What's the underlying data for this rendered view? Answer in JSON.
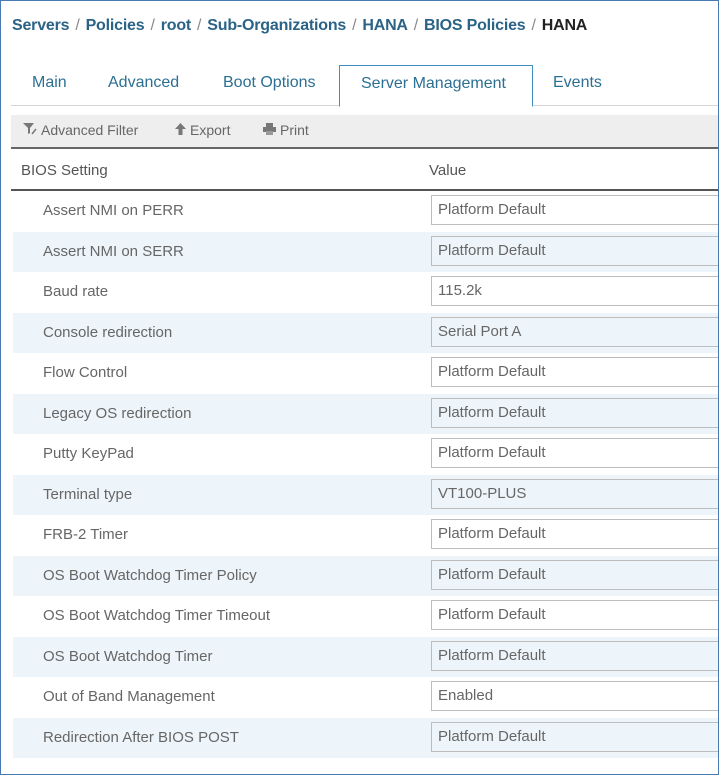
{
  "breadcrumb": {
    "items": [
      "Servers",
      "Policies",
      "root",
      "Sub-Organizations",
      "HANA",
      "BIOS Policies"
    ],
    "current": "HANA",
    "separator": "/"
  },
  "tabs": [
    {
      "label": "Main",
      "active": false
    },
    {
      "label": "Advanced",
      "active": false
    },
    {
      "label": "Boot Options",
      "active": false
    },
    {
      "label": "Server Management",
      "active": true
    },
    {
      "label": "Events",
      "active": false
    }
  ],
  "toolbar": {
    "filter": {
      "label": "Advanced Filter",
      "icon": "filter-icon"
    },
    "export": {
      "label": "Export",
      "icon": "arrow-up-icon"
    },
    "print": {
      "label": "Print",
      "icon": "printer-icon"
    }
  },
  "table": {
    "columns": [
      "BIOS Setting",
      "Value"
    ],
    "rows": [
      {
        "setting": "Assert NMI on PERR",
        "value": "Platform Default"
      },
      {
        "setting": "Assert NMI on SERR",
        "value": "Platform Default"
      },
      {
        "setting": "Baud rate",
        "value": "115.2k"
      },
      {
        "setting": "Console redirection",
        "value": "Serial Port A"
      },
      {
        "setting": "Flow Control",
        "value": "Platform Default"
      },
      {
        "setting": "Legacy OS redirection",
        "value": "Platform Default"
      },
      {
        "setting": "Putty KeyPad",
        "value": "Platform Default"
      },
      {
        "setting": "Terminal type",
        "value": "VT100-PLUS"
      },
      {
        "setting": "FRB-2 Timer",
        "value": "Platform Default"
      },
      {
        "setting": "OS Boot Watchdog Timer Policy",
        "value": "Platform Default"
      },
      {
        "setting": "OS Boot Watchdog Timer Timeout",
        "value": "Platform Default"
      },
      {
        "setting": "OS Boot Watchdog Timer",
        "value": "Platform Default"
      },
      {
        "setting": "Out of Band Management",
        "value": "Enabled"
      },
      {
        "setting": "Redirection After BIOS POST",
        "value": "Platform Default"
      }
    ]
  },
  "colors": {
    "link": "#2b6387",
    "tab_active_border": "#3f8fc2",
    "row_alt": "#eef5fa",
    "frame_border": "#4a78b0"
  }
}
